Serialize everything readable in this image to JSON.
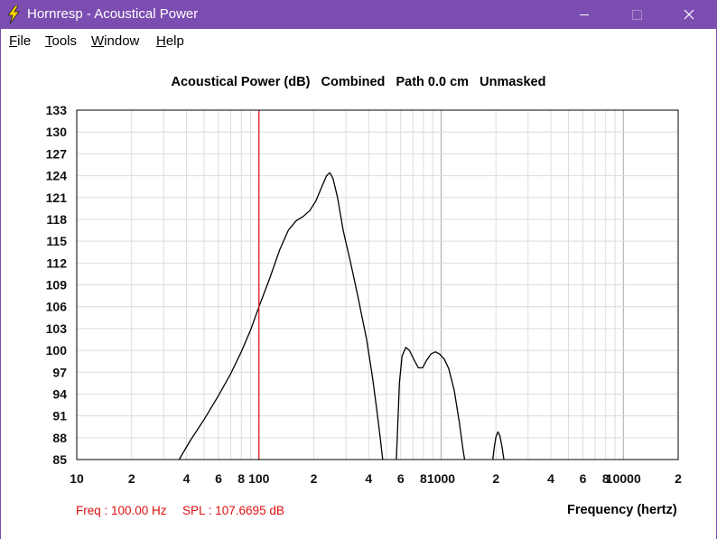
{
  "window": {
    "title": "Hornresp - Acoustical Power",
    "app_icon": "lightning-bolt-icon",
    "controls": [
      "minimize-icon",
      "maximize-icon",
      "close-icon"
    ]
  },
  "menu": {
    "items": [
      {
        "label": "File",
        "accel": "F",
        "rest": "ile"
      },
      {
        "label": "Tools",
        "accel": "T",
        "rest": "ools"
      },
      {
        "label": "Window",
        "accel": "W",
        "rest": "indow"
      },
      {
        "label": "Help",
        "accel": "H",
        "rest": "elp"
      }
    ]
  },
  "readout": {
    "freq": "Freq : 100.00 Hz",
    "spl": "SPL : 107.6695 dB"
  },
  "colors": {
    "titlebar": "#7b4db0",
    "curve": "#000000",
    "cursor": "#e01010",
    "readout_text": "#e01010",
    "grid_minor": "#dcdcdc",
    "grid_major": "#a8a8a8"
  },
  "chart_data": {
    "type": "line",
    "title": "Acoustical Power (dB)   Combined   Path 0.0 cm   Unmasked",
    "xlabel": "Frequency (hertz)",
    "ylabel": "",
    "x_scale": "log",
    "xlim": [
      10,
      20000
    ],
    "ylim": [
      85,
      133
    ],
    "y_ticks": [
      "133",
      "130",
      "127",
      "124",
      "121",
      "118",
      "115",
      "112",
      "109",
      "106",
      "103",
      "100",
      "97",
      "94",
      "91",
      "88",
      "85"
    ],
    "x_ticks": [
      {
        "value": 10,
        "label": "10"
      },
      {
        "value": 20,
        "label": "2"
      },
      {
        "value": 40,
        "label": "4"
      },
      {
        "value": 60,
        "label": "6"
      },
      {
        "value": 80,
        "label": "8"
      },
      {
        "value": 100,
        "label": "100"
      },
      {
        "value": 200,
        "label": "2"
      },
      {
        "value": 400,
        "label": "4"
      },
      {
        "value": 600,
        "label": "6"
      },
      {
        "value": 800,
        "label": "8"
      },
      {
        "value": 1000,
        "label": "1000"
      },
      {
        "value": 2000,
        "label": "2"
      },
      {
        "value": 4000,
        "label": "4"
      },
      {
        "value": 6000,
        "label": "6"
      },
      {
        "value": 8000,
        "label": "8"
      },
      {
        "value": 10000,
        "label": "10000"
      },
      {
        "value": 20000,
        "label": "2"
      }
    ],
    "grid": true,
    "cursor": {
      "x": 100
    },
    "series": [
      {
        "segments": [
          [
            [
              36.5,
              85
            ],
            [
              42,
              87.6
            ],
            [
              50,
              90.5
            ],
            [
              60,
              93.8
            ],
            [
              70,
              96.8
            ],
            [
              80,
              99.8
            ],
            [
              90,
              102.8
            ],
            [
              100,
              106
            ],
            [
              115,
              110
            ],
            [
              130,
              113.8
            ],
            [
              145,
              116.5
            ],
            [
              160,
              117.8
            ],
            [
              175,
              118.4
            ],
            [
              190,
              119.2
            ],
            [
              205,
              120.5
            ],
            [
              220,
              122.3
            ],
            [
              235,
              124.0
            ],
            [
              245,
              124.4
            ],
            [
              255,
              123.6
            ],
            [
              270,
              121.0
            ],
            [
              290,
              116.5
            ],
            [
              320,
              111.8
            ],
            [
              350,
              107.3
            ],
            [
              390,
              101.5
            ],
            [
              420,
              96.3
            ],
            [
              445,
              91.5
            ],
            [
              465,
              87.6
            ],
            [
              478,
              85
            ]
          ],
          [
            [
              568,
              85
            ],
            [
              578,
              89.8
            ],
            [
              590,
              95.5
            ],
            [
              610,
              99.2
            ],
            [
              640,
              100.4
            ],
            [
              670,
              100.0
            ],
            [
              710,
              98.7
            ],
            [
              750,
              97.6
            ],
            [
              790,
              97.6
            ],
            [
              830,
              98.6
            ],
            [
              880,
              99.5
            ],
            [
              930,
              99.8
            ],
            [
              980,
              99.5
            ],
            [
              1040,
              98.8
            ],
            [
              1100,
              97.5
            ],
            [
              1180,
              94.5
            ],
            [
              1260,
              90.0
            ],
            [
              1320,
              86.3
            ],
            [
              1345,
              85
            ]
          ],
          [
            [
              1920,
              85
            ],
            [
              1960,
              86.8
            ],
            [
              2000,
              88.1
            ],
            [
              2050,
              88.8
            ],
            [
              2100,
              88.3
            ],
            [
              2160,
              86.7
            ],
            [
              2210,
              85
            ]
          ]
        ]
      }
    ]
  }
}
